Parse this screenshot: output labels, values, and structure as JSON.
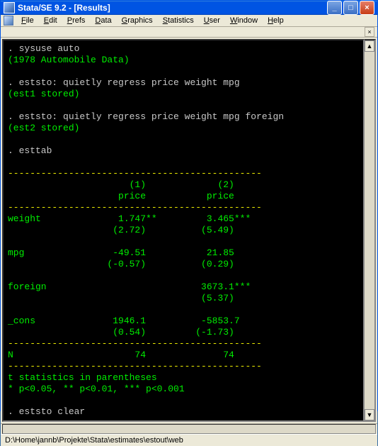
{
  "window": {
    "title": "Stata/SE 9.2 - [Results]"
  },
  "menus": {
    "file": "File",
    "edit": "Edit",
    "prefs": "Prefs",
    "data": "Data",
    "graphics": "Graphics",
    "statistics": "Statistics",
    "user": "User",
    "window": "Window",
    "help": "Help"
  },
  "console": {
    "cmd1": ". sysuse auto",
    "msg1": "(1978 Automobile Data)",
    "cmd2": ". eststo: quietly regress price weight mpg",
    "msg2": "(est1 stored)",
    "cmd3": ". eststo: quietly regress price weight mpg foreign",
    "msg3": "(est2 stored)",
    "cmd4": ". esttab",
    "rule": "----------------------------------------------",
    "hdr1": "                      (1)             (2)   ",
    "hdr2": "                    price           price   ",
    "r_weight_a": "weight              1.747**         3.465***",
    "r_weight_b": "                   (2.72)          (5.49)   ",
    "r_mpg_a": "mpg                -49.51           21.85   ",
    "r_mpg_b": "                  (-0.57)          (0.29)   ",
    "r_for_a": "foreign                            3673.1***",
    "r_for_b": "                                   (5.37)   ",
    "r_cons_a": "_cons              1946.1          -5853.7   ",
    "r_cons_b": "                   (0.54)         (-1.73)   ",
    "r_N": "N                      74              74   ",
    "foot1": "t statistics in parentheses",
    "foot2": "* p<0.05, ** p<0.01, *** p<0.001",
    "cmd5": ". eststo clear"
  },
  "statusbar": {
    "path": "D:\\Home\\jannb\\Projekte\\Stata\\estimates\\estout\\web"
  },
  "chart_data": {
    "type": "table",
    "title": "esttab regression output",
    "columns": [
      "(1) price",
      "(2) price"
    ],
    "rows": [
      {
        "label": "weight",
        "coef": [
          1.747,
          3.465
        ],
        "t": [
          2.72,
          5.49
        ],
        "stars": [
          "**",
          "***"
        ]
      },
      {
        "label": "mpg",
        "coef": [
          -49.51,
          21.85
        ],
        "t": [
          -0.57,
          0.29
        ],
        "stars": [
          "",
          ""
        ]
      },
      {
        "label": "foreign",
        "coef": [
          null,
          3673.1
        ],
        "t": [
          null,
          5.37
        ],
        "stars": [
          "",
          "***"
        ]
      },
      {
        "label": "_cons",
        "coef": [
          1946.1,
          -5853.7
        ],
        "t": [
          0.54,
          -1.73
        ],
        "stars": [
          "",
          ""
        ]
      }
    ],
    "N": [
      74,
      74
    ],
    "notes": [
      "t statistics in parentheses",
      "* p<0.05, ** p<0.01, *** p<0.001"
    ]
  }
}
